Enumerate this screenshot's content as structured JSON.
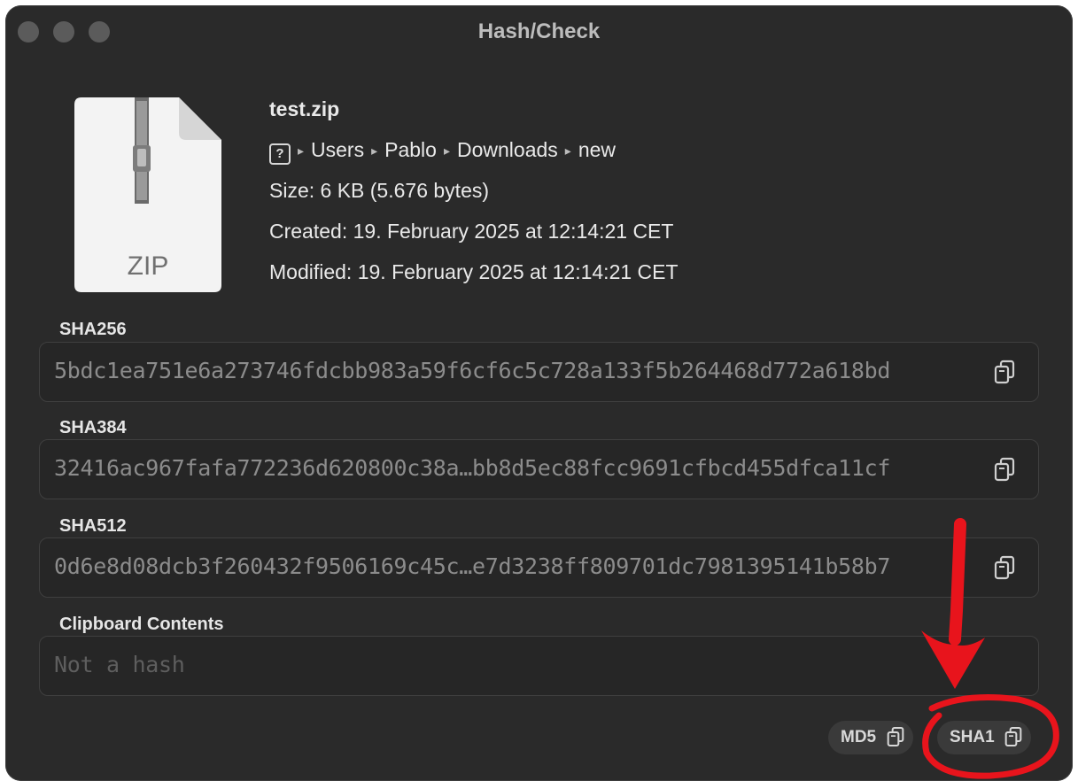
{
  "window": {
    "title": "Hash/Check"
  },
  "file": {
    "name": "test.zip",
    "icon_label": "ZIP",
    "path": [
      "Users",
      "Pablo",
      "Downloads",
      "new"
    ],
    "size": "Size: 6 KB  (5.676 bytes)",
    "created": "Created: 19. February 2025 at 12:14:21 CET",
    "modified": "Modified: 19. February 2025 at 12:14:21 CET"
  },
  "hashes": [
    {
      "label": "SHA256",
      "value": "5bdc1ea751e6a273746fdcbb983a59f6cf6c5c728a133f5b264468d772a618bd"
    },
    {
      "label": "SHA384",
      "value": "32416ac967fafa772236d620800c38a…bb8d5ec88fcc9691cfbcd455dfca11cf"
    },
    {
      "label": "SHA512",
      "value": "0d6e8d08dcb3f260432f9506169c45c…e7d3238ff809701dc7981395141b58b7"
    }
  ],
  "clipboard": {
    "label": "Clipboard Contents",
    "placeholder": "Not a hash"
  },
  "buttons": {
    "md5": "MD5",
    "sha1": "SHA1"
  },
  "colors": {
    "annotation": "#e8141c",
    "window_bg": "#2a2a2a"
  }
}
